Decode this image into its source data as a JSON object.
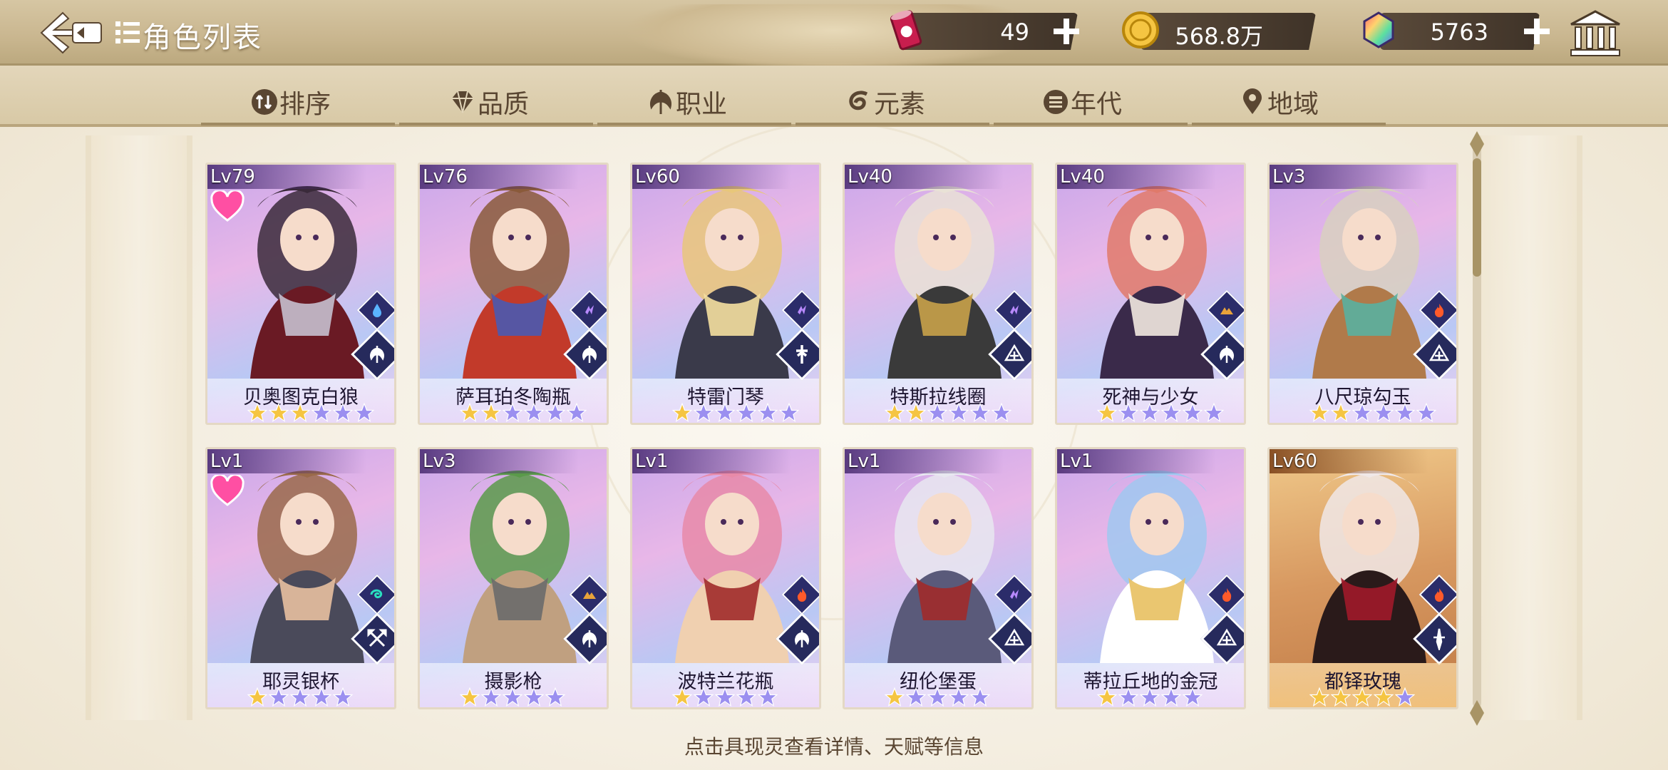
{
  "header": {
    "title": "角色列表",
    "resources": [
      {
        "icon": "ticket-can-icon",
        "value": "49"
      },
      {
        "icon": "gold-coin-icon",
        "value": "568.8万"
      },
      {
        "icon": "rainbow-gem-icon",
        "value": "5763"
      }
    ]
  },
  "tabs": [
    {
      "label": "排序",
      "icon": "sort-icon"
    },
    {
      "label": "品质",
      "icon": "quality-gem-icon"
    },
    {
      "label": "职业",
      "icon": "profession-icon"
    },
    {
      "label": "元素",
      "icon": "element-swirl-icon"
    },
    {
      "label": "年代",
      "icon": "era-icon"
    },
    {
      "label": "地域",
      "icon": "location-pin-icon"
    }
  ],
  "cards": [
    {
      "level": "Lv79",
      "name": "贝奥图克白狼",
      "stars": 3,
      "max_stars": 6,
      "favorite": true,
      "element": "water",
      "class": "melee"
    },
    {
      "level": "Lv76",
      "name": "萨耳珀冬陶瓶",
      "stars": 2,
      "max_stars": 6,
      "favorite": false,
      "element": "thunder",
      "class": "melee"
    },
    {
      "level": "Lv60",
      "name": "特雷门琴",
      "stars": 1,
      "max_stars": 6,
      "favorite": false,
      "element": "thunder",
      "class": "support"
    },
    {
      "level": "Lv40",
      "name": "特斯拉线圈",
      "stars": 2,
      "max_stars": 6,
      "favorite": false,
      "element": "thunder",
      "class": "mage"
    },
    {
      "level": "Lv40",
      "name": "死神与少女",
      "stars": 1,
      "max_stars": 6,
      "favorite": false,
      "element": "earth",
      "class": "melee"
    },
    {
      "level": "Lv3",
      "name": "八尺琼勾玉",
      "stars": 2,
      "max_stars": 6,
      "favorite": false,
      "element": "fire",
      "class": "mage"
    },
    {
      "level": "Lv1",
      "name": "耶灵银杯",
      "stars": 1,
      "max_stars": 5,
      "favorite": true,
      "element": "wind",
      "class": "tank"
    },
    {
      "level": "Lv3",
      "name": "摄影枪",
      "stars": 1,
      "max_stars": 5,
      "favorite": false,
      "element": "earth",
      "class": "melee"
    },
    {
      "level": "Lv1",
      "name": "波特兰花瓶",
      "stars": 1,
      "max_stars": 5,
      "favorite": false,
      "element": "fire",
      "class": "melee"
    },
    {
      "level": "Lv1",
      "name": "纽伦堡蛋",
      "stars": 1,
      "max_stars": 5,
      "favorite": false,
      "element": "thunder",
      "class": "mage"
    },
    {
      "level": "Lv1",
      "name": "蒂拉丘地的金冠",
      "stars": 1,
      "max_stars": 5,
      "favorite": false,
      "element": "fire",
      "class": "mage"
    },
    {
      "level": "Lv60",
      "name": "都铎玫瑰",
      "stars": 4,
      "max_stars": 5,
      "favorite": false,
      "element": "fire",
      "class": "assassin",
      "rarity": "gold"
    }
  ],
  "footer": {
    "hint": "点击具现灵查看详情、天赋等信息"
  },
  "colors": {
    "star_active": "#f5c542",
    "star_inactive": "#9b8ff0",
    "card_border": "#e4d8c4",
    "header_bg": "#c9b68f"
  }
}
